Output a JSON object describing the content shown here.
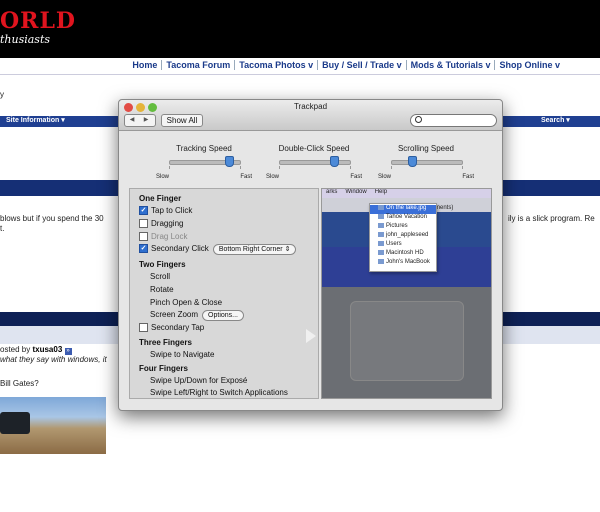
{
  "site": {
    "logo_text": "ORLD",
    "logo_sub": "thusiasts",
    "nav": [
      "Home",
      "Tacoma Forum",
      "Tacoma Photos v",
      "Buy / Sell / Trade v",
      "Mods & Tutorials v",
      "Shop Online v"
    ],
    "crumb": "y",
    "bar_left": "Site Information ▾",
    "bar_right": "Search ▾",
    "line1_left": " blows but if you spend the 30",
    "line1_right": "ily is a slick program. Re",
    "line2": "t.",
    "posted_prefix": "osted by ",
    "posted_user": "txusa03",
    "post_quote": "what they say with windows, it",
    "gates": " Bill Gates?"
  },
  "window": {
    "title": "Trackpad",
    "back": "◀",
    "forward": "▶",
    "show_all": "Show All",
    "search_placeholder": "",
    "speeds": [
      {
        "label": "Tracking Speed",
        "slow": "Slow",
        "fast": "Fast",
        "level": 0.85
      },
      {
        "label": "Double-Click Speed",
        "slow": "Slow",
        "fast": "Fast",
        "level": 0.78
      },
      {
        "label": "Scrolling Speed",
        "slow": "Slow",
        "fast": "Fast",
        "level": 0.3
      }
    ],
    "one_finger": "One Finger",
    "tap_to_click": "Tap to Click",
    "dragging": "Dragging",
    "drag_lock": "Drag Lock",
    "secondary_click": "Secondary Click",
    "secondary_click_value": "Bottom Right Corner",
    "two_fingers": "Two Fingers",
    "scroll": "Scroll",
    "rotate": "Rotate",
    "pinch": "Pinch Open & Close",
    "screen_zoom": "Screen Zoom",
    "options": "Options...",
    "secondary_tap": "Secondary Tap",
    "three_fingers": "Three Fingers",
    "swipe_navigate": "Swipe to Navigate",
    "four_fingers": "Four Fingers",
    "expose": "Swipe Up/Down for Exposé",
    "switch_apps": "Swipe Left/Right to Switch Applications"
  },
  "preview": {
    "menubar": [
      "arks",
      "Window",
      "Help"
    ],
    "doc": "documents)",
    "menu_items": [
      "On the lake.jpg",
      "Tahoe Vacation",
      "Pictures",
      "john_appleseed",
      "Users",
      "Macintosh HD",
      "John's MacBook"
    ]
  }
}
